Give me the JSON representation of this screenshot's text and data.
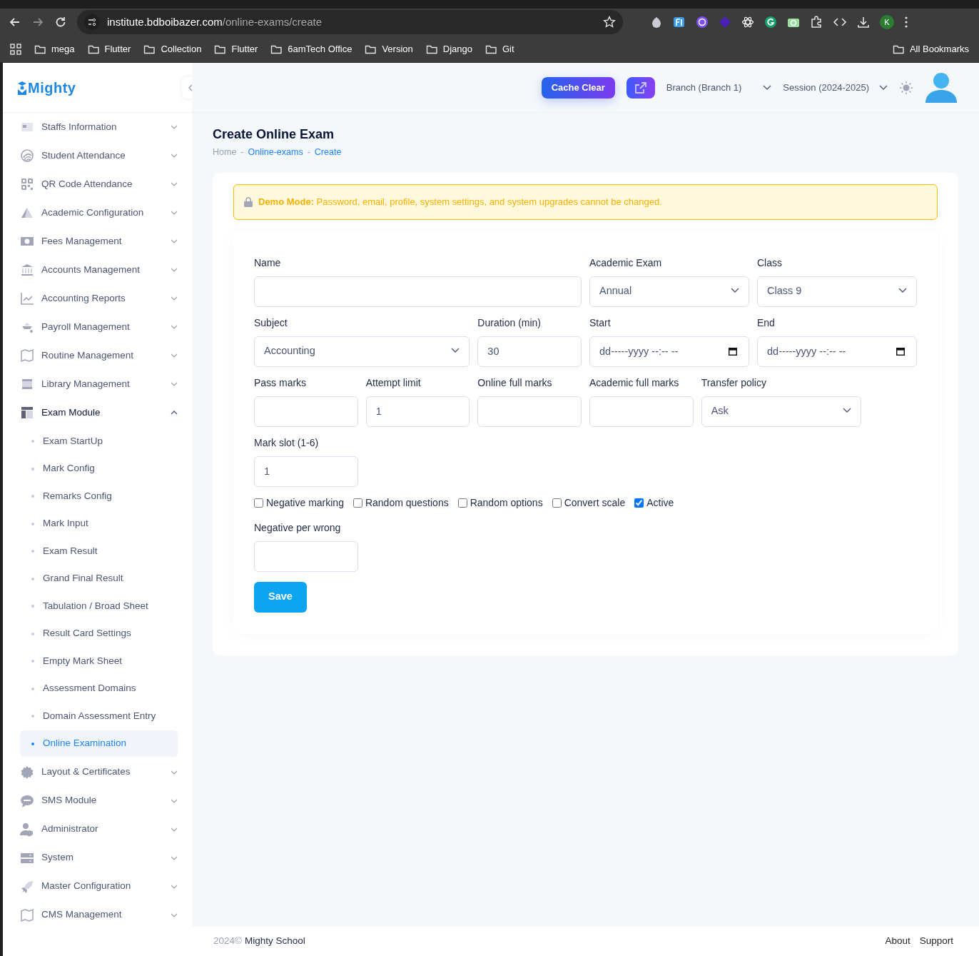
{
  "browser": {
    "url_host": "institute.bdboibazer.com",
    "url_path": "/online-exams/create",
    "profile": "K",
    "bookmarks": [
      "mega",
      "Flutter",
      "Collection",
      "Flutter",
      "6amTech Office",
      "Version",
      "Django",
      "Git"
    ],
    "all_bookmarks": "All Bookmarks"
  },
  "header": {
    "logo": "Mighty",
    "cache_button": "Cache Clear",
    "branch": "Branch (Branch 1)",
    "session": "Session (2024-2025)"
  },
  "sidebar": {
    "items": [
      {
        "label": "Staffs Information",
        "expanded": false
      },
      {
        "label": "Student Attendance",
        "expanded": false
      },
      {
        "label": "QR Code Attendance",
        "expanded": false
      },
      {
        "label": "Academic Configuration",
        "expanded": false
      },
      {
        "label": "Fees Management",
        "expanded": false
      },
      {
        "label": "Accounts Management",
        "expanded": false
      },
      {
        "label": "Accounting Reports",
        "expanded": false
      },
      {
        "label": "Payroll Management",
        "expanded": false
      },
      {
        "label": "Routine Management",
        "expanded": false
      },
      {
        "label": "Library Management",
        "expanded": false
      },
      {
        "label": "Exam Module",
        "expanded": true,
        "children": [
          {
            "label": "Exam StartUp",
            "selected": false
          },
          {
            "label": "Mark Config",
            "selected": false
          },
          {
            "label": "Remarks Config",
            "selected": false
          },
          {
            "label": "Mark Input",
            "selected": false
          },
          {
            "label": "Exam Result",
            "selected": false
          },
          {
            "label": "Grand Final Result",
            "selected": false
          },
          {
            "label": "Tabulation / Broad Sheet",
            "selected": false
          },
          {
            "label": "Result Card Settings",
            "selected": false
          },
          {
            "label": "Empty Mark Sheet",
            "selected": false
          },
          {
            "label": "Assessment Domains",
            "selected": false
          },
          {
            "label": "Domain Assessment Entry",
            "selected": false
          },
          {
            "label": "Online Examination",
            "selected": true
          }
        ]
      },
      {
        "label": "Layout & Certificates",
        "expanded": false
      },
      {
        "label": "SMS Module",
        "expanded": false
      },
      {
        "label": "Administrator",
        "expanded": false
      },
      {
        "label": "System",
        "expanded": false
      },
      {
        "label": "Master Configuration",
        "expanded": false
      },
      {
        "label": "CMS Management",
        "expanded": false
      }
    ]
  },
  "page": {
    "title": "Create Online Exam",
    "separator": "-",
    "breadcrumb": [
      {
        "label": "Home",
        "selected": false
      },
      {
        "label": "Online-exams",
        "selected": true
      },
      {
        "label": "Create",
        "selected": true
      }
    ]
  },
  "alert": {
    "text": "**Demo Mode:** Password, email, profile, system settings, and system upgrades cannot be changed."
  },
  "form": {
    "fields": [
      {
        "label": "Name",
        "kind": "text"
      },
      {
        "label": "Academic Exam",
        "kind": "select",
        "value": "Annual"
      },
      {
        "label": "Class",
        "kind": "select",
        "value": "Class 9"
      },
      {
        "label": "Subject",
        "kind": "select",
        "value": "Accounting"
      },
      {
        "label": "Duration (min)",
        "kind": "text",
        "value": "30"
      },
      {
        "label": "Start",
        "kind": "datetime",
        "placeholder": "dd-----yyyy --:-- --"
      },
      {
        "label": "End",
        "kind": "datetime",
        "placeholder": "dd-----yyyy --:-- --"
      },
      {
        "label": "Pass marks",
        "kind": "text"
      },
      {
        "label": "Attempt limit",
        "kind": "text",
        "value": "1"
      },
      {
        "label": "Online full marks",
        "kind": "text"
      },
      {
        "label": "Academic full marks",
        "kind": "text"
      },
      {
        "label": "Transfer policy",
        "kind": "select",
        "value": "Ask"
      },
      {
        "label": "Mark slot (1-6)",
        "kind": "text",
        "value": "1"
      }
    ],
    "checkboxes": [
      {
        "label": "Negative marking",
        "checked": false
      },
      {
        "label": "Random questions",
        "checked": false
      },
      {
        "label": "Random options",
        "checked": false
      },
      {
        "label": "Convert scale",
        "checked": false
      },
      {
        "label": "Active",
        "checked": true
      }
    ],
    "negative_field": {
      "label": "Negative per wrong"
    },
    "save_button": "Save"
  },
  "footer": {
    "copyright": "2024©",
    "brand": "Mighty School",
    "links": [
      "About",
      "Support"
    ]
  }
}
